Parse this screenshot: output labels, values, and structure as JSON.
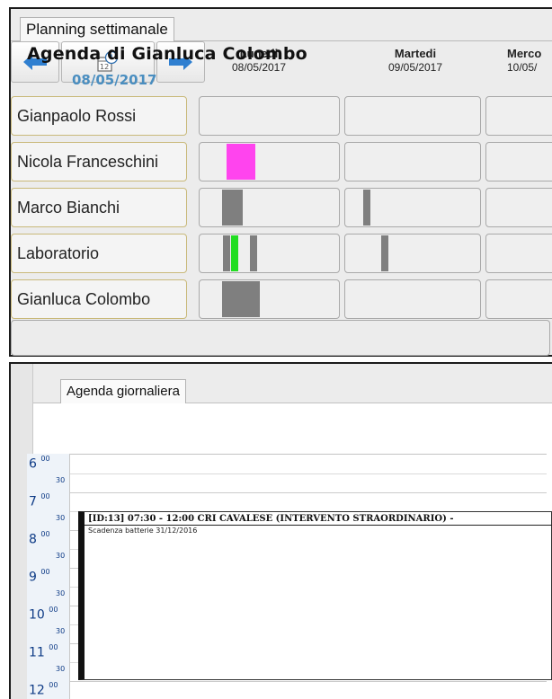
{
  "weekly": {
    "tab": "Planning settimanale",
    "nav": {
      "prev_icon": "arrow-left-icon",
      "today_icon": "calendar-clock-icon",
      "next_icon": "arrow-right-icon"
    },
    "days": [
      {
        "name": "Lunedi",
        "date": "08/05/2017"
      },
      {
        "name": "Martedi",
        "date": "09/05/2017"
      },
      {
        "name": "Merco",
        "date": "10/05/"
      }
    ],
    "people": [
      {
        "name": "Gianpaolo Rossi"
      },
      {
        "name": "Nicola Franceschini"
      },
      {
        "name": "Marco Bianchi"
      },
      {
        "name": "Laboratorio"
      },
      {
        "name": "Gianluca Colombo"
      }
    ],
    "colors": {
      "pink": "#ff44ee",
      "gray": "#7f7f7f",
      "green": "#22dd22"
    }
  },
  "daily": {
    "tab": "Agenda giornaliera",
    "title": "Agenda di Gianluca Colombo",
    "date": "08/05/2017",
    "hours": [
      "6",
      "7",
      "8",
      "9",
      "10",
      "11",
      "12"
    ],
    "minute_zero": "00",
    "minute_half": "30",
    "event": {
      "title": "[ID:13] 07:30 - 12:00 CRI CAVALESE (INTERVENTO STRAORDINARIO) -",
      "note": "Scadenza batterie 31/12/2016"
    },
    "colors": {
      "date": "#4a8ec0",
      "hour": "#0e3b86"
    }
  }
}
